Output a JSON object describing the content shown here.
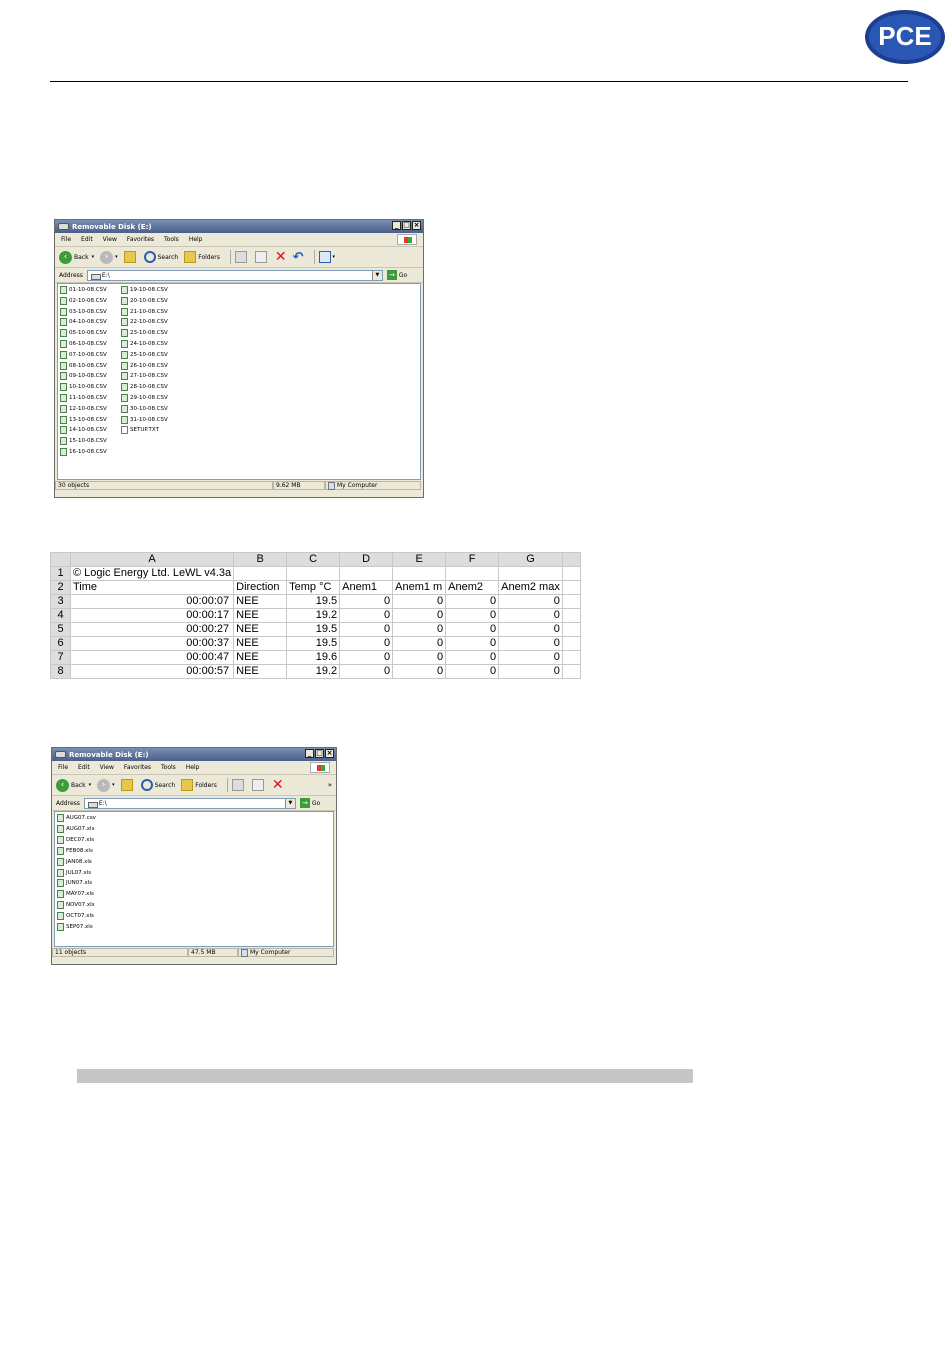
{
  "logo": {
    "text": "PCE"
  },
  "window1": {
    "title": "Removable Disk (E:)",
    "menu": [
      "File",
      "Edit",
      "View",
      "Favorites",
      "Tools",
      "Help"
    ],
    "toolbar": {
      "back": "Back",
      "search": "Search",
      "folders": "Folders"
    },
    "address_label": "Address",
    "address_value": "E:\\",
    "go_label": "Go",
    "files_col1": [
      "01-10-08.CSV",
      "02-10-08.CSV",
      "03-10-08.CSV",
      "04-10-08.CSV",
      "05-10-08.CSV",
      "06-10-08.CSV",
      "07-10-08.CSV",
      "08-10-08.CSV",
      "09-10-08.CSV",
      "10-10-08.CSV",
      "11-10-08.CSV",
      "12-10-08.CSV",
      "13-10-08.CSV",
      "14-10-08.CSV",
      "15-10-08.CSV",
      "16-10-08.CSV"
    ],
    "files_col2": [
      "19-10-08.CSV",
      "20-10-08.CSV",
      "21-10-08.CSV",
      "22-10-08.CSV",
      "23-10-08.CSV",
      "24-10-08.CSV",
      "25-10-08.CSV",
      "26-10-08.CSV",
      "27-10-08.CSV",
      "28-10-08.CSV",
      "29-10-08.CSV",
      "30-10-08.CSV",
      "31-10-08.CSV",
      "SETUP.TXT"
    ],
    "status": {
      "objects": "30 objects",
      "size": "9.62 MB",
      "location": "My Computer"
    }
  },
  "spreadsheet": {
    "columns": [
      "A",
      "B",
      "C",
      "D",
      "E",
      "F",
      "G"
    ],
    "rows": [
      {
        "n": "1",
        "cells": [
          "© Logic Energy Ltd. LeWL v4.3a",
          "",
          "",
          "",
          "",
          "",
          ""
        ]
      },
      {
        "n": "2",
        "cells": [
          "Time",
          "Direction",
          "Temp °C",
          "Anem1",
          "Anem1 m",
          "Anem2",
          "Anem2 max"
        ]
      },
      {
        "n": "3",
        "cells": [
          "00:00:07",
          "NEE",
          "19.5",
          "0",
          "0",
          "0",
          "0"
        ]
      },
      {
        "n": "4",
        "cells": [
          "00:00:17",
          "NEE",
          "19.2",
          "0",
          "0",
          "0",
          "0"
        ]
      },
      {
        "n": "5",
        "cells": [
          "00:00:27",
          "NEE",
          "19.5",
          "0",
          "0",
          "0",
          "0"
        ]
      },
      {
        "n": "6",
        "cells": [
          "00:00:37",
          "NEE",
          "19.5",
          "0",
          "0",
          "0",
          "0"
        ]
      },
      {
        "n": "7",
        "cells": [
          "00:00:47",
          "NEE",
          "19.6",
          "0",
          "0",
          "0",
          "0"
        ]
      },
      {
        "n": "8",
        "cells": [
          "00:00:57",
          "NEE",
          "19.2",
          "0",
          "0",
          "0",
          "0"
        ]
      }
    ]
  },
  "window2": {
    "title": "Removable Disk (E:)",
    "menu": [
      "File",
      "Edit",
      "View",
      "Favorites",
      "Tools",
      "Help"
    ],
    "toolbar": {
      "back": "Back",
      "search": "Search",
      "folders": "Folders"
    },
    "address_label": "Address",
    "address_value": "E:\\",
    "go_label": "Go",
    "files": [
      "AUG07.csv",
      "AUG07.xls",
      "DEC07.xls",
      "FEB08.xls",
      "JAN08.xls",
      "JUL07.xls",
      "JUN07.xls",
      "MAY07.xls",
      "NOV07.xls",
      "OCT07.xls",
      "SEP07.xls"
    ],
    "status": {
      "objects": "11 objects",
      "size": "47.5 MB",
      "location": "My Computer"
    }
  }
}
